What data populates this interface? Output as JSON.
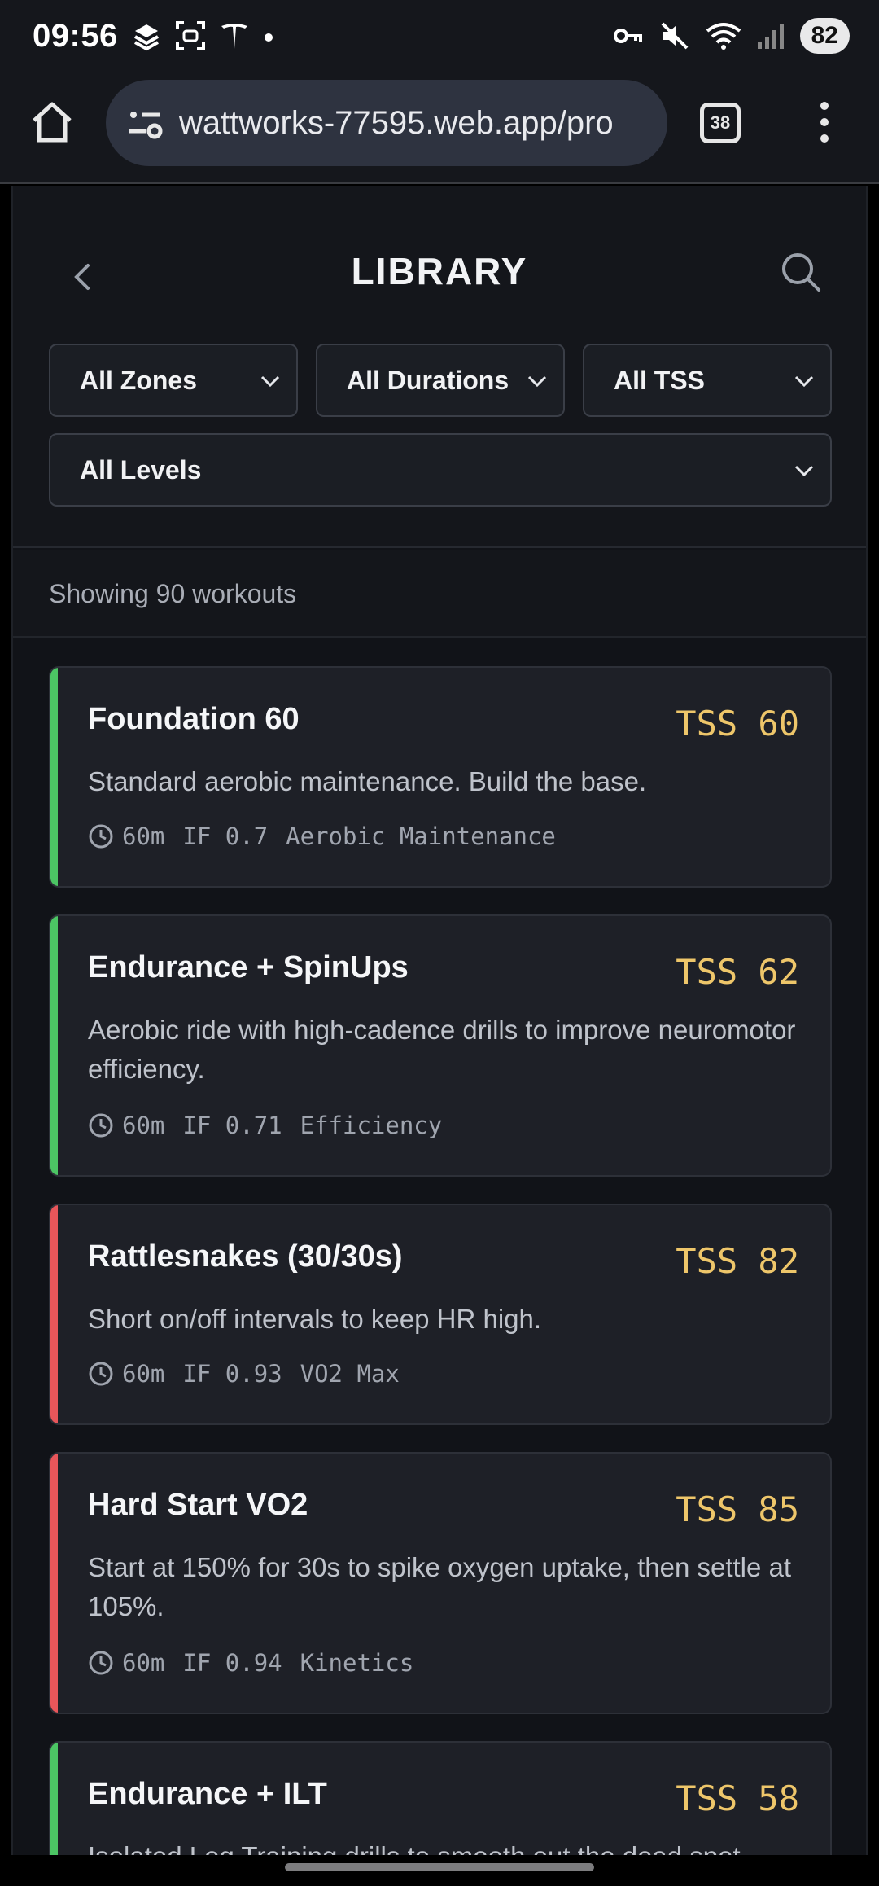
{
  "status": {
    "time": "09:56",
    "battery": "82"
  },
  "browser": {
    "url": "wattworks-77595.web.app/pro",
    "tab_count": "38"
  },
  "header": {
    "title": "LIBRARY"
  },
  "filters": [
    {
      "label": "All Zones"
    },
    {
      "label": "All Durations"
    },
    {
      "label": "All TSS"
    },
    {
      "label": "All Levels"
    }
  ],
  "summary": {
    "count_text": "Showing 90 workouts"
  },
  "colors": {
    "endurance": "#4cc564",
    "intensity": "#e8565a",
    "tss": "#eec66a"
  },
  "workouts": [
    {
      "name": "Foundation 60",
      "tss": "TSS 60",
      "description": "Standard aerobic maintenance. Build the base.",
      "duration": "60m",
      "if": "IF 0.7",
      "category": "Aerobic Maintenance",
      "accent": "#4cc564"
    },
    {
      "name": "Endurance + SpinUps",
      "tss": "TSS 62",
      "description": "Aerobic ride with high-cadence drills to improve neuromotor efficiency.",
      "duration": "60m",
      "if": "IF 0.71",
      "category": "Efficiency",
      "accent": "#4cc564"
    },
    {
      "name": "Rattlesnakes (30/30s)",
      "tss": "TSS 82",
      "description": "Short on/off intervals to keep HR high.",
      "duration": "60m",
      "if": "IF 0.93",
      "category": "VO2 Max",
      "accent": "#e8565a"
    },
    {
      "name": "Hard Start VO2",
      "tss": "TSS 85",
      "description": "Start at 150% for 30s to spike oxygen uptake, then settle at 105%.",
      "duration": "60m",
      "if": "IF 0.94",
      "category": "Kinetics",
      "accent": "#e8565a"
    },
    {
      "name": "Endurance + ILT",
      "tss": "TSS 58",
      "description": "Isolated Leg Training drills to smooth out the dead spot.",
      "accent": "#4cc564"
    }
  ]
}
